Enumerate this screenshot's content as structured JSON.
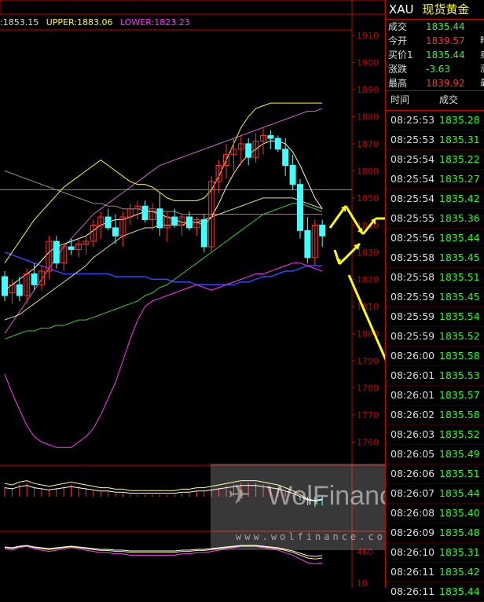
{
  "legend": {
    "mid": ":1853.15",
    "upper": "UPPER:1883.06",
    "lower": "LOWER:1823.23"
  },
  "colors": {
    "upper": "#ffff00",
    "lower": "#ff33ff",
    "mid": "#ffffff",
    "up_candle": "#ff3030",
    "down_candle": "#40ffff",
    "axis": "#c00000",
    "tick_price": "#22ff22"
  },
  "chart_data": {
    "type": "candlestick",
    "ylim": [
      1752,
      1912
    ],
    "y_ticks": [
      1760,
      1770,
      1780,
      1790,
      1800,
      1810,
      1820,
      1830,
      1840,
      1850,
      1860,
      1870,
      1880,
      1890,
      1900,
      1910
    ],
    "y_tick_labels": [
      "1760",
      "1770",
      "1780",
      "1790",
      "1800",
      "1810",
      "1820",
      "1830",
      "1840",
      "1850",
      "1860",
      "1870",
      "1880",
      "1890",
      "1900",
      "1910"
    ],
    "candles": [
      [
        1821,
        1823,
        1812,
        1814
      ],
      [
        1815,
        1820,
        1811,
        1818
      ],
      [
        1818,
        1821,
        1812,
        1814
      ],
      [
        1814,
        1824,
        1811,
        1822
      ],
      [
        1822,
        1826,
        1816,
        1818
      ],
      [
        1818,
        1825,
        1816,
        1823
      ],
      [
        1823,
        1836,
        1820,
        1834
      ],
      [
        1834,
        1836,
        1824,
        1826
      ],
      [
        1826,
        1833,
        1823,
        1832
      ],
      [
        1832,
        1835,
        1829,
        1831
      ],
      [
        1831,
        1835,
        1828,
        1833
      ],
      [
        1833,
        1836,
        1829,
        1834
      ],
      [
        1834,
        1842,
        1832,
        1840
      ],
      [
        1840,
        1845,
        1835,
        1843
      ],
      [
        1843,
        1846,
        1838,
        1839
      ],
      [
        1839,
        1844,
        1833,
        1836
      ],
      [
        1836,
        1845,
        1832,
        1843
      ],
      [
        1843,
        1848,
        1840,
        1846
      ],
      [
        1846,
        1849,
        1842,
        1847
      ],
      [
        1847,
        1849,
        1841,
        1842
      ],
      [
        1842,
        1848,
        1838,
        1846
      ],
      [
        1846,
        1852,
        1836,
        1839
      ],
      [
        1839,
        1845,
        1834,
        1843
      ],
      [
        1843,
        1846,
        1839,
        1840
      ],
      [
        1840,
        1844,
        1836,
        1843
      ],
      [
        1843,
        1845,
        1838,
        1839
      ],
      [
        1839,
        1843,
        1836,
        1842
      ],
      [
        1842,
        1844,
        1830,
        1832
      ],
      [
        1832,
        1858,
        1830,
        1856
      ],
      [
        1856,
        1864,
        1852,
        1862
      ],
      [
        1862,
        1870,
        1857,
        1866
      ],
      [
        1866,
        1872,
        1860,
        1868
      ],
      [
        1868,
        1873,
        1862,
        1870
      ],
      [
        1870,
        1872,
        1862,
        1865
      ],
      [
        1865,
        1874,
        1863,
        1871
      ],
      [
        1871,
        1876,
        1866,
        1873
      ],
      [
        1873,
        1875,
        1868,
        1872
      ],
      [
        1872,
        1873,
        1867,
        1868
      ],
      [
        1868,
        1872,
        1858,
        1862
      ],
      [
        1862,
        1866,
        1853,
        1855
      ],
      [
        1855,
        1857,
        1835,
        1838
      ],
      [
        1838,
        1843,
        1826,
        1828
      ],
      [
        1828,
        1842,
        1825,
        1840
      ],
      [
        1840,
        1842,
        1832,
        1836
      ]
    ],
    "bands": {
      "upper": [
        1826,
        1830,
        1834,
        1838,
        1842,
        1845,
        1848,
        1851,
        1854,
        1856,
        1858,
        1860,
        1862,
        1864,
        1862,
        1860,
        1858,
        1856,
        1855,
        1855,
        1854,
        1852,
        1850,
        1849,
        1849,
        1849,
        1849,
        1850,
        1853,
        1858,
        1864,
        1870,
        1876,
        1880,
        1883,
        1884,
        1885,
        1885,
        1885,
        1885,
        1885,
        1885,
        1885,
        1885
      ],
      "lower": [
        1785,
        1778,
        1772,
        1766,
        1762,
        1760,
        1759,
        1758,
        1758,
        1758,
        1760,
        1762,
        1765,
        1770,
        1776,
        1782,
        1790,
        1798,
        1805,
        1810,
        1812,
        1813,
        1814,
        1815,
        1816,
        1817,
        1818,
        1817,
        1816,
        1817,
        1818,
        1819,
        1820,
        1821,
        1822,
        1822,
        1823,
        1824,
        1825,
        1826,
        1826,
        1825,
        1824,
        1823
      ],
      "mid": [
        1805,
        1806,
        1807,
        1809,
        1811,
        1813,
        1815,
        1817,
        1819,
        1821,
        1823,
        1825,
        1828,
        1830,
        1832,
        1834,
        1836,
        1837,
        1838,
        1839,
        1839,
        1840,
        1840,
        1840,
        1840,
        1841,
        1841,
        1842,
        1843,
        1844,
        1845,
        1846,
        1847,
        1848,
        1849,
        1850,
        1850,
        1850,
        1850,
        1850,
        1849,
        1848,
        1847,
        1846
      ]
    },
    "ma_white": [
      1860,
      1859,
      1858,
      1857,
      1856,
      1855,
      1854,
      1853,
      1852,
      1851,
      1850,
      1849,
      1848,
      1848,
      1847,
      1847,
      1846,
      1846,
      1846,
      1845,
      1845,
      1845,
      1845,
      1845,
      1844,
      1844,
      1844,
      1844,
      1844,
      1844,
      1844,
      1844,
      1844,
      1844,
      1844,
      1844,
      1844,
      1844,
      1844,
      1844,
      1844,
      1844,
      1844,
      1844
    ],
    "ma_yellow_fast": [
      1816,
      1818,
      1820,
      1822,
      1824,
      1827,
      1830,
      1832,
      1833,
      1834,
      1835,
      1836,
      1838,
      1840,
      1841,
      1842,
      1842,
      1843,
      1844,
      1845,
      1845,
      1844,
      1843,
      1842,
      1841,
      1841,
      1841,
      1840,
      1843,
      1848,
      1854,
      1859,
      1863,
      1866,
      1868,
      1870,
      1871,
      1871,
      1870,
      1867,
      1862,
      1856,
      1850,
      1846
    ],
    "ma_green": [
      1798,
      1799,
      1800,
      1801,
      1801,
      1802,
      1802,
      1803,
      1803,
      1804,
      1805,
      1805,
      1806,
      1807,
      1808,
      1809,
      1810,
      1811,
      1812,
      1814,
      1815,
      1817,
      1818,
      1820,
      1822,
      1824,
      1826,
      1828,
      1830,
      1832,
      1834,
      1836,
      1838,
      1840,
      1842,
      1844,
      1845,
      1846,
      1847,
      1848,
      1848,
      1847,
      1846,
      1845
    ],
    "ma_blue": [
      1830,
      1829,
      1828,
      1827,
      1826,
      1825,
      1824,
      1823,
      1822,
      1822,
      1822,
      1822,
      1822,
      1822,
      1822,
      1821,
      1821,
      1821,
      1821,
      1821,
      1820,
      1820,
      1820,
      1819,
      1819,
      1819,
      1818,
      1818,
      1818,
      1818,
      1818,
      1818,
      1819,
      1819,
      1820,
      1821,
      1821,
      1822,
      1823,
      1823,
      1824,
      1825,
      1825,
      1825
    ],
    "ma_magenta": [
      1800,
      1804,
      1808,
      1812,
      1816,
      1820,
      1824,
      1828,
      1832,
      1835,
      1838,
      1841,
      1844,
      1846,
      1848,
      1850,
      1852,
      1854,
      1856,
      1858,
      1860,
      1862,
      1863,
      1864,
      1865,
      1866,
      1867,
      1868,
      1869,
      1870,
      1871,
      1872,
      1873,
      1874,
      1875,
      1876,
      1877,
      1878,
      1879,
      1880,
      1881,
      1882,
      1882,
      1883
    ],
    "hline_magenta": 1853,
    "macd": [
      0.6,
      0.5,
      0.7,
      0.8,
      0.6,
      0.5,
      0.4,
      0.5,
      0.6,
      0.7,
      0.6,
      0.5,
      0.4,
      0.3,
      0.3,
      0.2,
      0.2,
      0.1,
      0.1,
      0.1,
      0.1,
      0.1,
      0.1,
      0.1,
      0.2,
      0.2,
      0.3,
      0.3,
      0.4,
      0.5,
      0.6,
      0.7,
      0.8,
      0.8,
      0.8,
      0.7,
      0.6,
      0.5,
      0.3,
      0.1,
      -0.2,
      -0.5,
      -0.6,
      -0.5
    ]
  },
  "quote": {
    "symbol": "XAU",
    "name": "现货黄金",
    "rows": [
      {
        "label": "成交",
        "value": "1835.44",
        "color": "#22ff22",
        "extra": ""
      },
      {
        "label": "今开",
        "value": "1839.57",
        "color": "#ff3030",
        "extra": "昨"
      },
      {
        "label": "买价1",
        "value": "1835.44",
        "color": "#22ff22",
        "extra": "卖"
      },
      {
        "label": "涨跌",
        "value": "-3.63",
        "color": "#22ff22",
        "extra": "涨"
      },
      {
        "label": "最高",
        "value": "1839.92",
        "color": "#ff3030",
        "extra": "最"
      }
    ]
  },
  "ticks_header": {
    "time": "时间",
    "price": "成交"
  },
  "ticks": [
    {
      "time": "08:25:53",
      "price": "1835.28"
    },
    {
      "time": "08:25:53",
      "price": "1835.31"
    },
    {
      "time": "08:25:54",
      "price": "1835.22"
    },
    {
      "time": "08:25:54",
      "price": "1835.27"
    },
    {
      "time": "08:25:54",
      "price": "1835.42"
    },
    {
      "time": "08:25:55",
      "price": "1835.36"
    },
    {
      "time": "08:25:56",
      "price": "1835.44"
    },
    {
      "time": "08:25:58",
      "price": "1835.45"
    },
    {
      "time": "08:25:58",
      "price": "1835.51"
    },
    {
      "time": "08:25:59",
      "price": "1835.45"
    },
    {
      "time": "08:25:59",
      "price": "1835.54"
    },
    {
      "time": "08:25:59",
      "price": "1835.52"
    },
    {
      "time": "08:26:00",
      "price": "1835.58"
    },
    {
      "time": "08:26:01",
      "price": "1835.53"
    },
    {
      "time": "08:26:01",
      "price": "1835.57"
    },
    {
      "time": "08:26:02",
      "price": "1835.58"
    },
    {
      "time": "08:26:03",
      "price": "1835.52"
    },
    {
      "time": "08:26:05",
      "price": "1835.49"
    },
    {
      "time": "08:26:06",
      "price": "1835.51"
    },
    {
      "time": "08:26:07",
      "price": "1835.44"
    },
    {
      "time": "08:26:08",
      "price": "1835.40"
    },
    {
      "time": "08:26:09",
      "price": "1835.48"
    },
    {
      "time": "08:26:10",
      "price": "1835.31"
    },
    {
      "time": "08:26:11",
      "price": "1835.42"
    },
    {
      "time": "08:26:11",
      "price": "1835.44"
    }
  ],
  "lower_axis": {
    "label_a": "460",
    "label_b": "10"
  },
  "watermark": {
    "brand": "WolFinance",
    "url": "www.wolfinance.com"
  }
}
